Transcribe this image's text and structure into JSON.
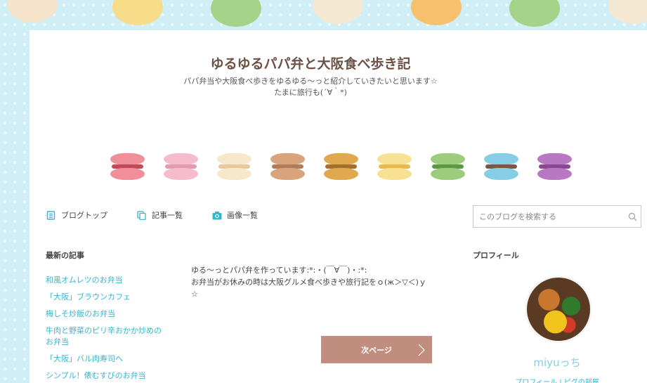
{
  "blog": {
    "title": "ゆるゆるパパ弁と大阪食べ歩き記",
    "subtitle_line1": "パパ弁当や大阪食べ歩きをゆるゆる〜っと紹介していきたいと思います☆",
    "subtitle_line2": "たまに旅行も(´∀｀*)"
  },
  "macarons": [
    {
      "name": "pink",
      "color": "#f08e9a",
      "cream": "#c14a58"
    },
    {
      "name": "light-pink",
      "color": "#f7bccb",
      "cream": "#e49ab0"
    },
    {
      "name": "cream",
      "color": "#f6e8c8",
      "cream": "#e8c99a"
    },
    {
      "name": "tan",
      "color": "#d9a37c",
      "cream": "#b07b58"
    },
    {
      "name": "caramel",
      "color": "#e0a94d",
      "cream": "#a46e2f"
    },
    {
      "name": "yellow",
      "color": "#f8e192",
      "cream": "#ecb84d"
    },
    {
      "name": "green",
      "color": "#9ccd7c",
      "cream": "#5c9748"
    },
    {
      "name": "blue",
      "color": "#86cde6",
      "cream": "#7a5847"
    },
    {
      "name": "purple",
      "color": "#b978c2",
      "cream": "#8a4893"
    }
  ],
  "nav": {
    "top": "ブログトップ",
    "articles": "記事一覧",
    "images": "画像一覧"
  },
  "search": {
    "placeholder": "このブログを検索する"
  },
  "sidebar": {
    "title": "最新の記事",
    "items": [
      "和風オムレツのお弁当",
      "「大阪」ブラウンカフェ",
      "梅しそ炒飯のお弁当",
      "牛肉と野菜のピリ辛おかか炒めのお弁当",
      "「大阪」バル肉寿司へ",
      "シンプル！俵むすびのお弁当"
    ]
  },
  "main": {
    "intro_line1": "ゆる〜っとパパ弁を作っています:*:・(￣∀￣)・:*:",
    "intro_line2": "お弁当がお休みの時は大阪グルメ食べ歩きや旅行記をｏ(ж＞▽＜)ｙ",
    "intro_line3": "☆",
    "next_button": "次ページ"
  },
  "profile": {
    "title": "プロフィール",
    "name": "miyuっち",
    "links": "プロフィール | ピグの部屋"
  }
}
